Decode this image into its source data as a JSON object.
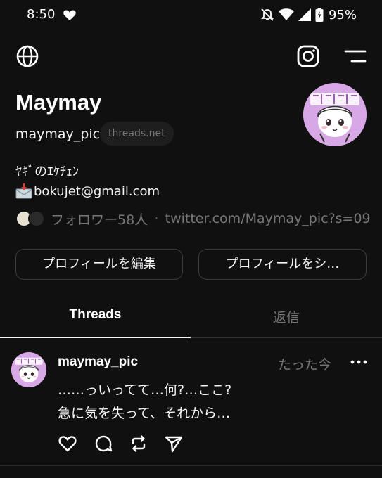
{
  "status_bar": {
    "time": "8:50",
    "battery_text": "95%"
  },
  "profile": {
    "name": "Maymay",
    "handle": "maymay_pic",
    "domain_chip": "threads.net",
    "bio_line1": "ﾔｷﾞのｴｹﾁｪﾝ",
    "bio_line2": "bokujet@gmail.com",
    "followers": "フォロワー58人",
    "link": "twitter.com/Maymay_pic?s=09"
  },
  "buttons": {
    "edit_profile": "プロフィールを編集",
    "share_profile": "プロフィールをシ…"
  },
  "tabs": {
    "threads": "Threads",
    "replies": "返信"
  },
  "post": {
    "username": "maymay_pic",
    "time": "たった今",
    "line1": "……っいってて…何?…ここ?",
    "line2": "急に気を失って、それから…"
  },
  "icons": {
    "globe": "globe-icon",
    "instagram": "instagram-icon",
    "menu": "menu-icon",
    "like": "heart-icon",
    "reply": "comment-icon",
    "repost": "repost-icon",
    "share": "send-icon"
  },
  "colors": {
    "background": "#101010",
    "text_primary": "#f3f5f7",
    "text_secondary": "#777777",
    "avatar_bg": "#d8a8e6"
  }
}
